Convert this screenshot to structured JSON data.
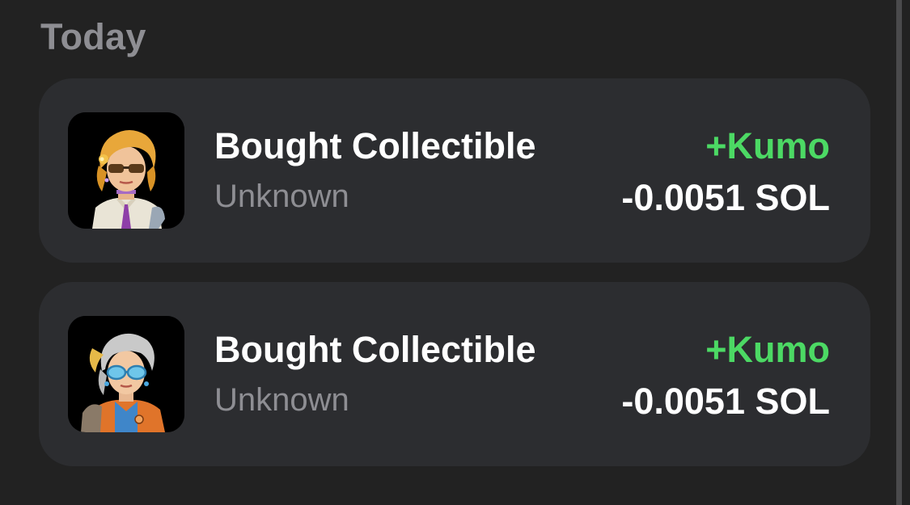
{
  "section": {
    "title": "Today"
  },
  "transactions": [
    {
      "title": "Bought Collectible",
      "subtitle": "Unknown",
      "gain": "+Kumo",
      "amount": "-0.0051 SOL",
      "thumbnail_icon": "nft-blonde-sunglasses-avatar"
    },
    {
      "title": "Bought Collectible",
      "subtitle": "Unknown",
      "gain": "+Kumo",
      "amount": "-0.0051 SOL",
      "thumbnail_icon": "nft-grey-hair-goggles-avatar"
    }
  ],
  "colors": {
    "background": "#222222",
    "card": "#2c2d30",
    "gain": "#4cd964",
    "secondary_text": "#8e8e93",
    "primary_text": "#ffffff"
  }
}
